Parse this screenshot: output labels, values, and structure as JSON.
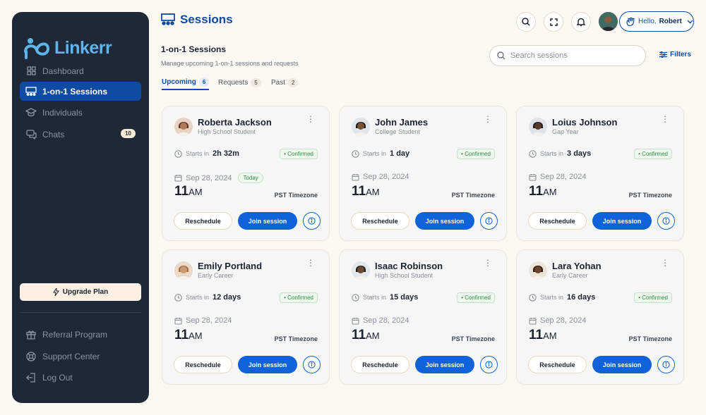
{
  "brand": {
    "name": "Linkerr"
  },
  "sidebar": {
    "items": [
      {
        "label": "Dashboard",
        "icon": "grid-icon"
      },
      {
        "label": "1-on-1 Sessions",
        "icon": "sessions-icon"
      },
      {
        "label": "Individuals",
        "icon": "graduation-cap-icon"
      },
      {
        "label": "Chats",
        "icon": "chat-icon",
        "badge": "10"
      }
    ],
    "upgrade_label": "Upgrade Plan",
    "bottom_items": [
      {
        "label": "Referral Program",
        "icon": "gift-icon"
      },
      {
        "label": "Support Center",
        "icon": "lifebuoy-icon"
      },
      {
        "label": "Log Out",
        "icon": "logout-icon"
      }
    ]
  },
  "header": {
    "title": "Sessions",
    "greeting": "Hello,",
    "user": "Robert"
  },
  "section": {
    "title": "1-on-1 Sessions",
    "subtitle": "Manage upcoming 1-on-1 sessions and requests"
  },
  "tabs": [
    {
      "label": "Upcoming",
      "count": "6"
    },
    {
      "label": "Requests",
      "count": "5"
    },
    {
      "label": "Past",
      "count": "2"
    }
  ],
  "search": {
    "placeholder": "Search sessions"
  },
  "filters_label": "Filters",
  "colors": {
    "primary": "#0f4aa3",
    "button": "#0f62d9",
    "sidebar": "#1e2837",
    "success": "#2f8a44"
  },
  "cards": [
    {
      "name": "Roberta Jackson",
      "role": "High School Student",
      "starts_label": "Starts in",
      "starts": "2h 32m",
      "status": "Confirmed",
      "date": "Sep 28, 2024",
      "today": "Today",
      "hour": "11",
      "ampm": "AM",
      "tz": "PST Timezone",
      "reschedule": "Reschedule",
      "join": "Join session"
    },
    {
      "name": "John James",
      "role": "College Student",
      "starts_label": "Starts in",
      "starts": "1 day",
      "status": "Confirmed",
      "date": "Sep 28, 2024",
      "today": "",
      "hour": "11",
      "ampm": "AM",
      "tz": "PST Timezone",
      "reschedule": "Reschedule",
      "join": "Join session"
    },
    {
      "name": "Loius Johnson",
      "role": "Gap Year",
      "starts_label": "Starts in",
      "starts": "3 days",
      "status": "Confirmed",
      "date": "Sep 28, 2024",
      "today": "",
      "hour": "11",
      "ampm": "AM",
      "tz": "PST Timezone",
      "reschedule": "Reschedule",
      "join": "Join session"
    },
    {
      "name": "Emily Portland",
      "role": "Early Career",
      "starts_label": "Starts in",
      "starts": "12 days",
      "status": "Confirmed",
      "date": "Sep 28, 2024",
      "today": "",
      "hour": "11",
      "ampm": "AM",
      "tz": "PST Timezone",
      "reschedule": "Reschedule",
      "join": "Join session"
    },
    {
      "name": "Isaac Robinson",
      "role": "High School Student",
      "starts_label": "Starts in",
      "starts": "15 days",
      "status": "Confirmed",
      "date": "Sep 28, 2024",
      "today": "",
      "hour": "11",
      "ampm": "AM",
      "tz": "PST Timezone",
      "reschedule": "Reschedule",
      "join": "Join session"
    },
    {
      "name": "Lara Yohan",
      "role": "Early Career",
      "starts_label": "Starts in",
      "starts": "16 days",
      "status": "Confirmed",
      "date": "Sep 28, 2024",
      "today": "",
      "hour": "11",
      "ampm": "AM",
      "tz": "PST Timezone",
      "reschedule": "Reschedule",
      "join": "Join session"
    }
  ]
}
